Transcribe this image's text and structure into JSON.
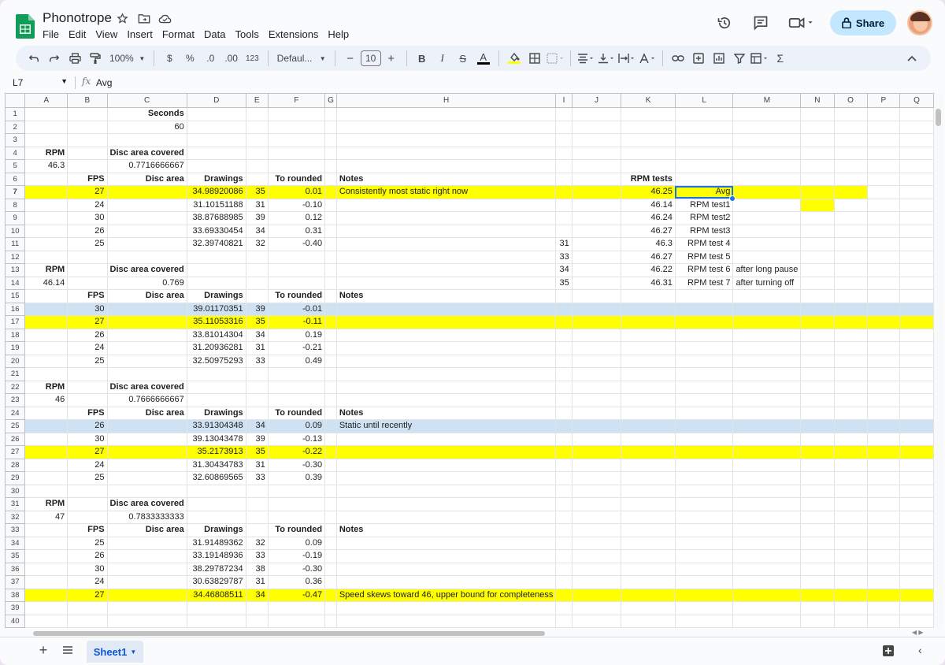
{
  "app": {
    "title": "Phonotrope",
    "menus": [
      "File",
      "Edit",
      "View",
      "Insert",
      "Format",
      "Data",
      "Tools",
      "Extensions",
      "Help"
    ],
    "share_label": "Share"
  },
  "toolbar": {
    "zoom": "100%",
    "currency": "$",
    "percent": "%",
    "dec_decrease": ".0",
    "dec_increase": ".00",
    "number_format": "123",
    "font": "Defaul...",
    "font_size": "10",
    "minus": "−",
    "plus": "+",
    "bold": "B",
    "italic": "I",
    "strike": "S",
    "text_color": "A",
    "sigma": "Σ"
  },
  "formula_bar": {
    "cell_ref": "L7",
    "fx": "fx",
    "content": "Avg"
  },
  "sheet": {
    "columns": [
      "A",
      "B",
      "C",
      "D",
      "E",
      "F",
      "G",
      "H",
      "I",
      "J",
      "K",
      "L",
      "M",
      "N",
      "O",
      "P",
      "Q"
    ],
    "selected_column": "L",
    "selected_row": 7,
    "active_cell": "L7",
    "colors": {
      "yellow": "#ffff00",
      "blue": "#cfe2f3",
      "selection": "#1a73e8"
    },
    "rows": [
      {
        "n": 1,
        "cells": {
          "C": {
            "v": "Seconds",
            "b": true,
            "a": "r"
          }
        }
      },
      {
        "n": 2,
        "cells": {
          "C": {
            "v": "60",
            "a": "r"
          }
        }
      },
      {
        "n": 3,
        "cells": {}
      },
      {
        "n": 4,
        "cells": {
          "A": {
            "v": "RPM",
            "b": true,
            "a": "r"
          },
          "C": {
            "v": "Disc area covered",
            "b": true,
            "a": "r"
          }
        }
      },
      {
        "n": 5,
        "cells": {
          "A": {
            "v": "46.3",
            "a": "r"
          },
          "C": {
            "v": "0.7716666667",
            "a": "r"
          }
        }
      },
      {
        "n": 6,
        "cells": {
          "B": {
            "v": "FPS",
            "b": true,
            "a": "r"
          },
          "C": {
            "v": "Disc area",
            "b": true,
            "a": "r"
          },
          "D": {
            "v": "Drawings",
            "b": true,
            "a": "r"
          },
          "F": {
            "v": "To rounded",
            "b": true,
            "a": "r"
          },
          "H": {
            "v": "Notes",
            "b": true
          },
          "K": {
            "v": "RPM tests",
            "b": true,
            "a": "r"
          }
        }
      },
      {
        "n": 7,
        "hl": "yellow",
        "hl_to": "O",
        "cells": {
          "B": {
            "v": "27",
            "a": "r"
          },
          "D": {
            "v": "34.98920086",
            "a": "r"
          },
          "E": {
            "v": "35",
            "a": "r"
          },
          "F": {
            "v": "0.01",
            "a": "r"
          },
          "H": {
            "v": "Consistently most static right now"
          },
          "K": {
            "v": "46.25",
            "a": "r"
          },
          "L": {
            "v": "Avg",
            "a": "r"
          }
        }
      },
      {
        "n": 8,
        "hl_cells": {
          "N": "yellow"
        },
        "cells": {
          "B": {
            "v": "24",
            "a": "r"
          },
          "D": {
            "v": "31.10151188",
            "a": "r"
          },
          "E": {
            "v": "31",
            "a": "r"
          },
          "F": {
            "v": "-0.10",
            "a": "r"
          },
          "K": {
            "v": "46.14",
            "a": "r"
          },
          "L": {
            "v": "RPM test1",
            "a": "r"
          }
        }
      },
      {
        "n": 9,
        "cells": {
          "B": {
            "v": "30",
            "a": "r"
          },
          "D": {
            "v": "38.87688985",
            "a": "r"
          },
          "E": {
            "v": "39",
            "a": "r"
          },
          "F": {
            "v": "0.12",
            "a": "r"
          },
          "K": {
            "v": "46.24",
            "a": "r"
          },
          "L": {
            "v": "RPM test2",
            "a": "r"
          }
        }
      },
      {
        "n": 10,
        "cells": {
          "B": {
            "v": "26",
            "a": "r"
          },
          "D": {
            "v": "33.69330454",
            "a": "r"
          },
          "E": {
            "v": "34",
            "a": "r"
          },
          "F": {
            "v": "0.31",
            "a": "r"
          },
          "K": {
            "v": "46.27",
            "a": "r"
          },
          "L": {
            "v": "RPM test3",
            "a": "r"
          }
        }
      },
      {
        "n": 11,
        "cells": {
          "B": {
            "v": "25",
            "a": "r"
          },
          "D": {
            "v": "32.39740821",
            "a": "r"
          },
          "E": {
            "v": "32",
            "a": "r"
          },
          "F": {
            "v": "-0.40",
            "a": "r"
          },
          "I": {
            "v": "31",
            "a": "r"
          },
          "K": {
            "v": "46.3",
            "a": "r"
          },
          "L": {
            "v": "RPM test 4",
            "a": "r"
          }
        }
      },
      {
        "n": 12,
        "cells": {
          "I": {
            "v": "33",
            "a": "r"
          },
          "K": {
            "v": "46.27",
            "a": "r"
          },
          "L": {
            "v": "RPM test 5",
            "a": "r"
          }
        }
      },
      {
        "n": 13,
        "cells": {
          "A": {
            "v": "RPM",
            "b": true,
            "a": "r"
          },
          "C": {
            "v": "Disc area covered",
            "b": true,
            "a": "r"
          },
          "I": {
            "v": "34",
            "a": "r"
          },
          "K": {
            "v": "46.22",
            "a": "r"
          },
          "L": {
            "v": "RPM test 6",
            "a": "r"
          },
          "M": {
            "v": "after long pause"
          }
        }
      },
      {
        "n": 14,
        "cells": {
          "A": {
            "v": "46.14",
            "a": "r"
          },
          "C": {
            "v": "0.769",
            "a": "r"
          },
          "I": {
            "v": "35",
            "a": "r"
          },
          "K": {
            "v": "46.31",
            "a": "r"
          },
          "L": {
            "v": "RPM test 7",
            "a": "r"
          },
          "M": {
            "v": "after turning off"
          }
        }
      },
      {
        "n": 15,
        "cells": {
          "B": {
            "v": "FPS",
            "b": true,
            "a": "r"
          },
          "C": {
            "v": "Disc area",
            "b": true,
            "a": "r"
          },
          "D": {
            "v": "Drawings",
            "b": true,
            "a": "r"
          },
          "F": {
            "v": "To rounded",
            "b": true,
            "a": "r"
          },
          "H": {
            "v": "Notes",
            "b": true
          }
        }
      },
      {
        "n": 16,
        "hl": "blue",
        "hl_to": "Q",
        "cells": {
          "B": {
            "v": "30",
            "a": "r"
          },
          "D": {
            "v": "39.01170351",
            "a": "r"
          },
          "E": {
            "v": "39",
            "a": "r"
          },
          "F": {
            "v": "-0.01",
            "a": "r"
          }
        }
      },
      {
        "n": 17,
        "hl": "yellow",
        "hl_to": "Q",
        "cells": {
          "B": {
            "v": "27",
            "a": "r"
          },
          "D": {
            "v": "35.11053316",
            "a": "r"
          },
          "E": {
            "v": "35",
            "a": "r"
          },
          "F": {
            "v": "-0.11",
            "a": "r"
          }
        }
      },
      {
        "n": 18,
        "cells": {
          "B": {
            "v": "26",
            "a": "r"
          },
          "D": {
            "v": "33.81014304",
            "a": "r"
          },
          "E": {
            "v": "34",
            "a": "r"
          },
          "F": {
            "v": "0.19",
            "a": "r"
          }
        }
      },
      {
        "n": 19,
        "cells": {
          "B": {
            "v": "24",
            "a": "r"
          },
          "D": {
            "v": "31.20936281",
            "a": "r"
          },
          "E": {
            "v": "31",
            "a": "r"
          },
          "F": {
            "v": "-0.21",
            "a": "r"
          }
        }
      },
      {
        "n": 20,
        "cells": {
          "B": {
            "v": "25",
            "a": "r"
          },
          "D": {
            "v": "32.50975293",
            "a": "r"
          },
          "E": {
            "v": "33",
            "a": "r"
          },
          "F": {
            "v": "0.49",
            "a": "r"
          }
        }
      },
      {
        "n": 21,
        "cells": {}
      },
      {
        "n": 22,
        "cells": {
          "A": {
            "v": "RPM",
            "b": true,
            "a": "r"
          },
          "C": {
            "v": "Disc area covered",
            "b": true,
            "a": "r"
          }
        }
      },
      {
        "n": 23,
        "cells": {
          "A": {
            "v": "46",
            "a": "r"
          },
          "C": {
            "v": "0.7666666667",
            "a": "r"
          }
        }
      },
      {
        "n": 24,
        "cells": {
          "B": {
            "v": "FPS",
            "b": true,
            "a": "r"
          },
          "C": {
            "v": "Disc area",
            "b": true,
            "a": "r"
          },
          "D": {
            "v": "Drawings",
            "b": true,
            "a": "r"
          },
          "F": {
            "v": "To rounded",
            "b": true,
            "a": "r"
          },
          "H": {
            "v": "Notes",
            "b": true
          }
        }
      },
      {
        "n": 25,
        "hl": "blue",
        "hl_to": "Q",
        "cells": {
          "B": {
            "v": "26",
            "a": "r"
          },
          "D": {
            "v": "33.91304348",
            "a": "r"
          },
          "E": {
            "v": "34",
            "a": "r"
          },
          "F": {
            "v": "0.09",
            "a": "r"
          },
          "H": {
            "v": "Static until recently"
          }
        }
      },
      {
        "n": 26,
        "cells": {
          "B": {
            "v": "30",
            "a": "r"
          },
          "D": {
            "v": "39.13043478",
            "a": "r"
          },
          "E": {
            "v": "39",
            "a": "r"
          },
          "F": {
            "v": "-0.13",
            "a": "r"
          }
        }
      },
      {
        "n": 27,
        "hl": "yellow",
        "hl_to": "Q",
        "cells": {
          "B": {
            "v": "27",
            "a": "r"
          },
          "D": {
            "v": "35.2173913",
            "a": "r"
          },
          "E": {
            "v": "35",
            "a": "r"
          },
          "F": {
            "v": "-0.22",
            "a": "r"
          }
        }
      },
      {
        "n": 28,
        "cells": {
          "B": {
            "v": "24",
            "a": "r"
          },
          "D": {
            "v": "31.30434783",
            "a": "r"
          },
          "E": {
            "v": "31",
            "a": "r"
          },
          "F": {
            "v": "-0.30",
            "a": "r"
          }
        }
      },
      {
        "n": 29,
        "cells": {
          "B": {
            "v": "25",
            "a": "r"
          },
          "D": {
            "v": "32.60869565",
            "a": "r"
          },
          "E": {
            "v": "33",
            "a": "r"
          },
          "F": {
            "v": "0.39",
            "a": "r"
          }
        }
      },
      {
        "n": 30,
        "cells": {}
      },
      {
        "n": 31,
        "cells": {
          "A": {
            "v": "RPM",
            "b": true,
            "a": "r"
          },
          "C": {
            "v": "Disc area covered",
            "b": true,
            "a": "r"
          }
        }
      },
      {
        "n": 32,
        "cells": {
          "A": {
            "v": "47",
            "a": "r"
          },
          "C": {
            "v": "0.7833333333",
            "a": "r"
          }
        }
      },
      {
        "n": 33,
        "cells": {
          "B": {
            "v": "FPS",
            "b": true,
            "a": "r"
          },
          "C": {
            "v": "Disc area",
            "b": true,
            "a": "r"
          },
          "D": {
            "v": "Drawings",
            "b": true,
            "a": "r"
          },
          "F": {
            "v": "To rounded",
            "b": true,
            "a": "r"
          },
          "H": {
            "v": "Notes",
            "b": true
          }
        }
      },
      {
        "n": 34,
        "cells": {
          "B": {
            "v": "25",
            "a": "r"
          },
          "D": {
            "v": "31.91489362",
            "a": "r"
          },
          "E": {
            "v": "32",
            "a": "r"
          },
          "F": {
            "v": "0.09",
            "a": "r"
          }
        }
      },
      {
        "n": 35,
        "cells": {
          "B": {
            "v": "26",
            "a": "r"
          },
          "D": {
            "v": "33.19148936",
            "a": "r"
          },
          "E": {
            "v": "33",
            "a": "r"
          },
          "F": {
            "v": "-0.19",
            "a": "r"
          }
        }
      },
      {
        "n": 36,
        "cells": {
          "B": {
            "v": "30",
            "a": "r"
          },
          "D": {
            "v": "38.29787234",
            "a": "r"
          },
          "E": {
            "v": "38",
            "a": "r"
          },
          "F": {
            "v": "-0.30",
            "a": "r"
          }
        }
      },
      {
        "n": 37,
        "cells": {
          "B": {
            "v": "24",
            "a": "r"
          },
          "D": {
            "v": "30.63829787",
            "a": "r"
          },
          "E": {
            "v": "31",
            "a": "r"
          },
          "F": {
            "v": "0.36",
            "a": "r"
          }
        }
      },
      {
        "n": 38,
        "hl": "yellow",
        "hl_to": "Q",
        "cells": {
          "B": {
            "v": "27",
            "a": "r"
          },
          "D": {
            "v": "34.46808511",
            "a": "r"
          },
          "E": {
            "v": "34",
            "a": "r"
          },
          "F": {
            "v": "-0.47",
            "a": "r"
          },
          "H": {
            "v": "Speed skews toward 46, upper bound for completeness"
          }
        }
      },
      {
        "n": 39,
        "cells": {}
      },
      {
        "n": 40,
        "cells": {}
      }
    ]
  },
  "bottom": {
    "add": "+",
    "sheet_tab": "Sheet1"
  }
}
